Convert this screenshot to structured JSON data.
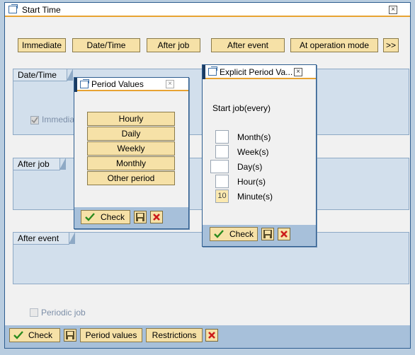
{
  "main_window": {
    "title": "Start Time",
    "buttons": [
      "Immediate",
      "Date/Time",
      "After job",
      "After event",
      "At operation mode",
      ">>"
    ],
    "groups": {
      "datetime": "Date/Time",
      "afterjob": "After job",
      "afterevent": "After event"
    },
    "immediate_checkbox": "Immediate",
    "periodic_checkbox": "Periodic job",
    "toolbar": {
      "check": "Check",
      "period_values": "Period values",
      "restrictions": "Restrictions"
    }
  },
  "period_dialog": {
    "title": "Period Values",
    "options": [
      "Hourly",
      "Daily",
      "Weekly",
      "Monthly",
      "Other period"
    ],
    "check": "Check"
  },
  "explicit_dialog": {
    "title": "Explicit Period Va...",
    "heading": "Start job(every)",
    "fields": [
      {
        "label": "Month(s)",
        "value": ""
      },
      {
        "label": "Week(s)",
        "value": ""
      },
      {
        "label": "Day(s)",
        "value": ""
      },
      {
        "label": "Hour(s)",
        "value": ""
      },
      {
        "label": "Minute(s)",
        "value": "10"
      }
    ],
    "check": "Check"
  },
  "colors": {
    "accent": "#e8a332",
    "button": "#f6e1a7",
    "frame": "#2e5d8f",
    "group": "#d2dfec"
  }
}
